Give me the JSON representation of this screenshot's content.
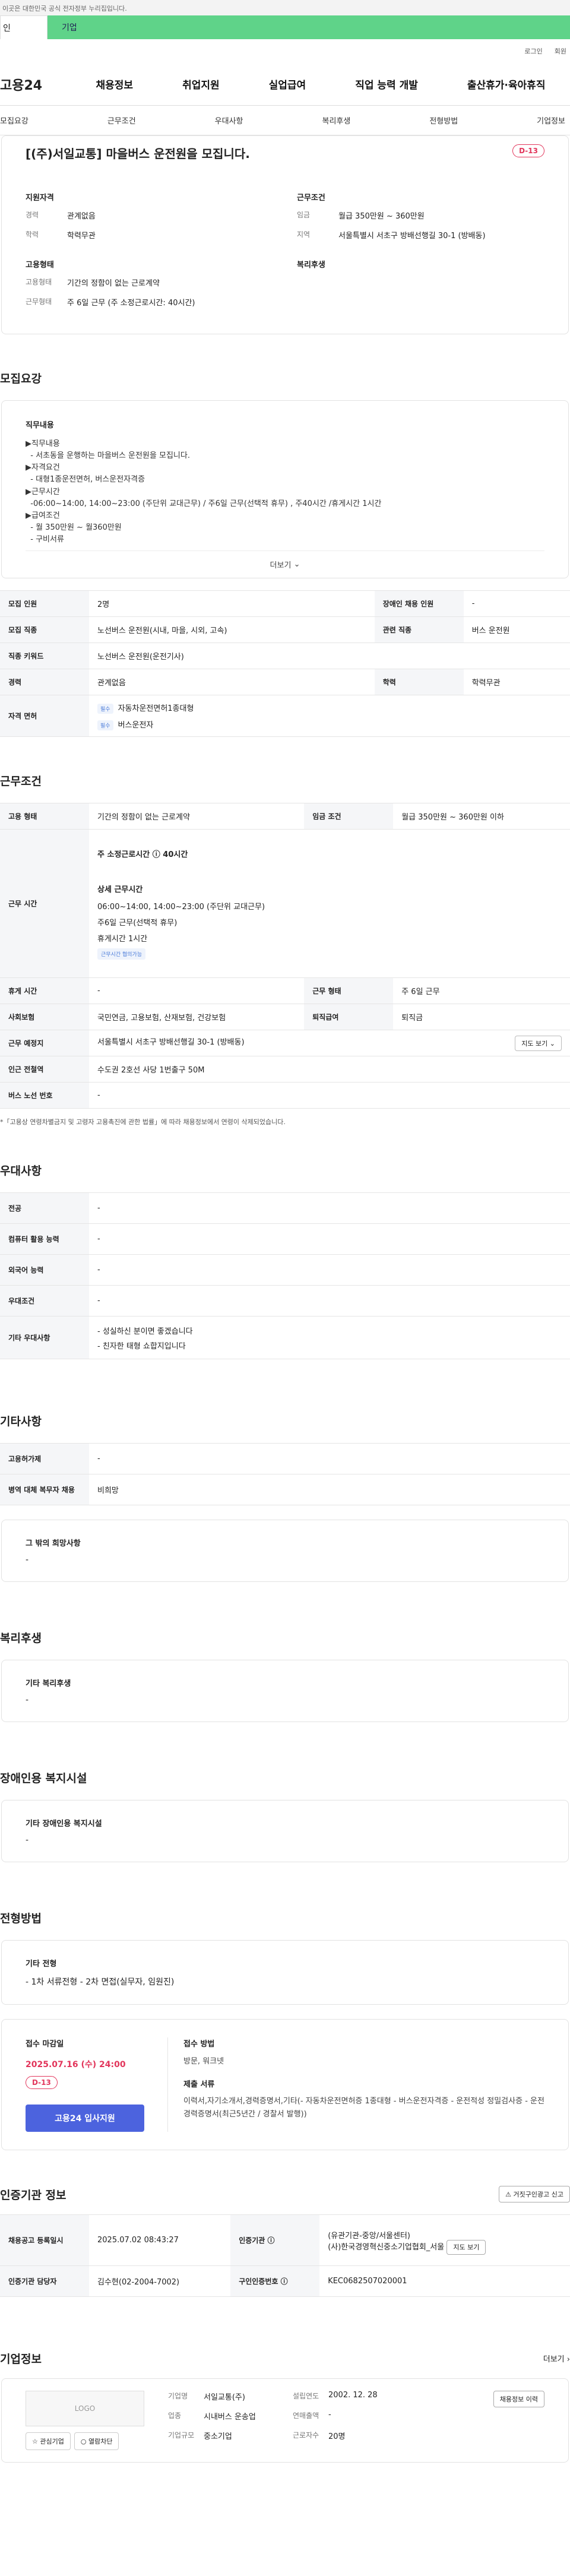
{
  "gov_notice": "이곳은 대한민국 공식 전자정부 누리집입니다.",
  "top_tabs": [
    "인",
    "기업"
  ],
  "util_links": [
    "로그인",
    "회원"
  ],
  "logo": "고용24",
  "gnb": [
    "채용정보",
    "취업지원",
    "실업급여",
    "직업 능력 개발",
    "출산휴가·육아휴직"
  ],
  "anchors": [
    "모집요강",
    "근무조건",
    "우대사항",
    "복리후생",
    "전형방법",
    "기업정보"
  ],
  "headline": {
    "title": "[(주)서일교통] 마을버스 운전원을 모집니다.",
    "dday": "D-13"
  },
  "summary": {
    "left_title": "지원자격",
    "career_k": "경력",
    "career_v": "관계없음",
    "edu_k": "학력",
    "edu_v": "학력무관",
    "type_title": "고용형태",
    "type_k": "고용형태",
    "type_v": "기간의 정함이 없는 근로계약",
    "hours_k": "근무형태",
    "hours_v": "주 6일 근무 (주 소정근로시간: 40시간)",
    "right_title": "근무조건",
    "wage_k": "임금",
    "wage_v": "월급 350만원 ~ 360만원",
    "region_k": "지역",
    "region_v": "서울특별시 서초구 방배선행길 30-1 (방배동)",
    "welfare_title": "복리후생"
  },
  "recruit": {
    "section_title": "모집요강",
    "duty_title": "직무내용",
    "duty_text": "▶직무내용\n  - 서초동을 운행하는 마을버스 운전원을 모집니다.\n▶자격요건\n  - 대형1종운전면허, 버스운전자격증\n▶근무시간\n  -06:00~14:00, 14:00~23:00 (주단위 교대근무) / 주6일 근무(선택적 휴무) , 주40시간 /휴게시간 1시간\n▶급여조건\n  - 월 350만원 ~ 월360만원\n  - 구비서류",
    "more": "더보기",
    "rows": [
      [
        "모집 인원",
        "2명",
        "장애인 채용 인원",
        "-"
      ],
      [
        "모집 직종",
        "노선버스 운전원(시내, 마을, 시외, 고속)",
        "관련 직종",
        "버스 운전원"
      ],
      [
        "직종 키워드",
        "노선버스 운전원(운전기사)"
      ],
      [
        "경력",
        "관계없음",
        "학력",
        "학력무관"
      ]
    ],
    "license_k": "자격 면허",
    "license_badge": "필수",
    "licenses": [
      "자동차운전면허1종대형",
      "버스운전자"
    ]
  },
  "work": {
    "section_title": "근무조건",
    "type_k": "고용 형태",
    "type_v": "기간의 정함이 없는 근로계약",
    "wage_k": "임금 조건",
    "wage_v": "월급 350만원 ~ 360만원 이하",
    "time_k": "근무 시간",
    "weekly": "주 소정근로시간 ⓘ 40시간",
    "detail_title": "상세 근무시간",
    "detail_1": "06:00~14:00, 14:00~23:00 (주단위 교대근무)",
    "detail_2": "주6일 근무(선택적 휴무)",
    "detail_3": "휴게시간 1시간",
    "detail_badge": "근무시간 협의가능",
    "rest_k": "휴게 시간",
    "rest_v": "-",
    "form_k": "근무 형태",
    "form_v": "주 6일 근무",
    "ins_k": "사회보험",
    "ins_v": "국민연금, 고용보험, 산재보험, 건강보험",
    "sev_k": "퇴직급여",
    "sev_v": "퇴직금",
    "place_k": "근무 예정지",
    "place_v": "서울특별시 서초구 방배선행길 30-1 (방배동)",
    "map": "지도 보기",
    "subway_k": "인근 전철역",
    "subway_v": "수도권 2호선 사당 1번출구 50M",
    "bus_k": "버스 노선 번호",
    "bus_v": "-",
    "note": "*「고용상 연령차별금지 및 고령자 고용촉진에 관한 법률」에 따라 채용정보에서 연령이 삭제되었습니다."
  },
  "pref": {
    "section_title": "우대사항",
    "rows": [
      [
        "전공",
        "-"
      ],
      [
        "컴퓨터 활용 능력",
        "-"
      ],
      [
        "외국어 능력",
        "-"
      ],
      [
        "우대조건",
        "-"
      ]
    ],
    "etc_k": "기타 우대사항",
    "etc_1": "- 성실하신 분이면 좋겠습니다",
    "etc_2": "- 친자한 태형 쇼합지입니다"
  },
  "others": {
    "section_title": "기타사항",
    "rows": [
      [
        "고용허가제",
        "-"
      ],
      [
        "병역 대체 복무자 채용",
        "비희망"
      ]
    ],
    "hope_title": "그 밖의 희망사항",
    "hope_v": "-"
  },
  "welfare": {
    "section_title": "복리후생",
    "t": "기타 복리후생",
    "v": "-"
  },
  "disabled": {
    "section_title": "장애인용 복지시설",
    "t": "기타 장애인용 복지시설",
    "v": "-"
  },
  "screening": {
    "section_title": "전형방법",
    "t": "기타 전형",
    "v": "- 1차 서류전형 - 2차 면접(실무자, 임원진)",
    "deadline_t": "접수 마감일",
    "deadline": "2025.07.16 (수) 24:00",
    "dday": "D-13",
    "apply_btn": "고용24 입사지원",
    "method_t": "접수 방법",
    "method_v": "방문, 워크넷",
    "docs_t": "제출 서류",
    "docs_v": "이력서,자기소개서,경력증명서,기타(- 자동차운전면허증 1종대형 - 버스운전자격증 - 운전적성 정밀검사증 - 운전경력증명서(최근5년간 / 경찰서 발행))"
  },
  "cert": {
    "section_title": "인증기관 정보",
    "report_btn": "거짓구인광고 신고",
    "reg_k": "채용공고 등록일시",
    "reg_v": "2025.07.02 08:43:27",
    "agency_k": "인증기관 ⓘ",
    "agency_v": "(유관기관-중앙/서울센터)\n(사)한국경영혁신중소기업협회_서울",
    "map_btn": "지도 보기",
    "manager_k": "인증기관 담당자",
    "manager_v": "김수현(02-2004-7002)",
    "id_k": "구인인증번호 ⓘ",
    "id_v": "KEC0682507020001"
  },
  "company": {
    "section_title": "기업정보",
    "more": "더보기",
    "logo": "LOGO",
    "fav": "관심기업",
    "block": "열람차단",
    "name_k": "기업명",
    "name_v": "서일교통(주)",
    "found_k": "설립연도",
    "found_v": "2002. 12. 28",
    "ind_k": "업종",
    "ind_v": "시내버스 운송업",
    "sales_k": "연매출액",
    "sales_v": "-",
    "size_k": "기업규모",
    "size_v": "중소기업",
    "emp_k": "근로자수",
    "emp_v": "20명",
    "jobs_btn": "채용정보 이력"
  }
}
